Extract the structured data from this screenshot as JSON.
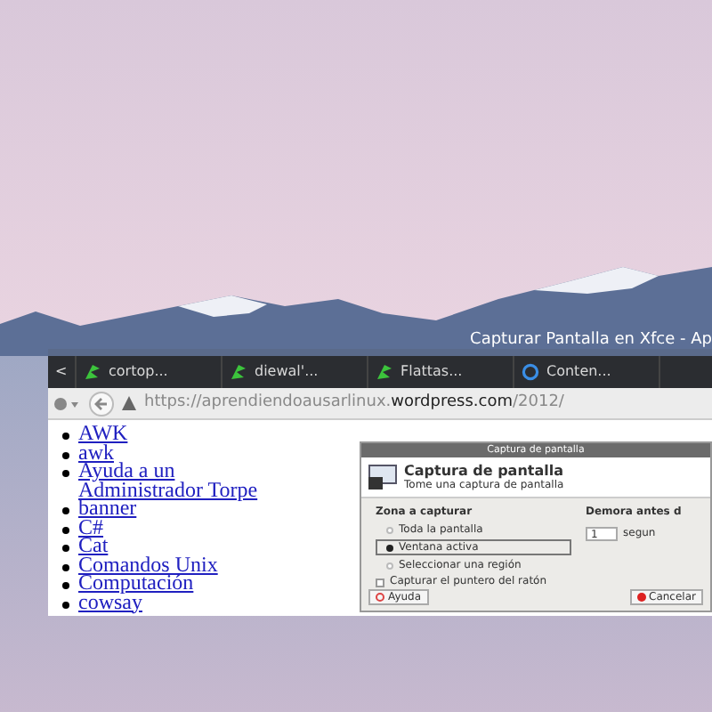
{
  "browser": {
    "title": "Capturar Pantalla en Xfce - Ap",
    "tabs": [
      {
        "label": "<",
        "kind": "nav",
        "selected": false
      },
      {
        "label": "cortop...",
        "kind": "site",
        "selected": false
      },
      {
        "label": "diewal'...",
        "kind": "site",
        "selected": false
      },
      {
        "label": "Flattas...",
        "kind": "site",
        "selected": false
      },
      {
        "label": "Conten...",
        "kind": "loading",
        "selected": false
      }
    ],
    "url": {
      "prefix": "https://aprendiendoausarlinux.",
      "domain": "wordpress.com",
      "path": "/2012/"
    },
    "links": [
      "AWK",
      "awk",
      "Ayuda a un Administrador Torpe",
      "banner",
      "C#",
      "Cat",
      "Comandos Unix",
      "Computación",
      "cowsay"
    ]
  },
  "dialog": {
    "title": "Captura de pantalla",
    "heading": "Captura de pantalla",
    "subtitle": "Tome una captura de pantalla",
    "zone_label": "Zona a capturar",
    "options": [
      {
        "label": "Toda la pantalla",
        "selected": false
      },
      {
        "label": "Ventana activa",
        "selected": true
      },
      {
        "label": "Seleccionar una región",
        "selected": false
      }
    ],
    "pointer": {
      "label": "Capturar el puntero del ratón",
      "checked": false
    },
    "delay_label": "Demora antes d",
    "delay_value": "1",
    "delay_unit": "segun",
    "help_button": "Ayuda",
    "cancel_button": "Cancelar"
  }
}
